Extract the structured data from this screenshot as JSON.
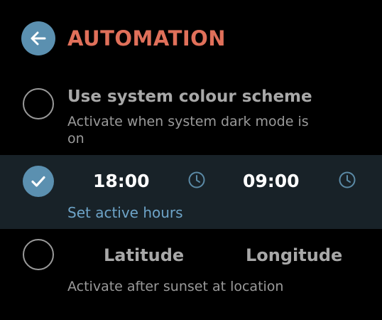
{
  "header": {
    "title": "AUTOMATION",
    "back_icon": "arrow-left-icon"
  },
  "options": {
    "system": {
      "title": "Use system colour scheme",
      "description_line1": "Activate when system dark mode is",
      "description_line2": "on",
      "selected": false
    },
    "hours": {
      "start_time": "18:00",
      "end_time": "09:00",
      "link_label": "Set active hours",
      "selected": true,
      "clock_icon": "clock-icon"
    },
    "location": {
      "latitude_label": "Latitude",
      "longitude_label": "Longitude",
      "description": "Activate after sunset at location",
      "selected": false
    }
  },
  "colors": {
    "accent": "#5b90b0",
    "title": "#e0705a",
    "link": "#6ea4c8",
    "selected_band": "#182228",
    "background": "#000000"
  }
}
